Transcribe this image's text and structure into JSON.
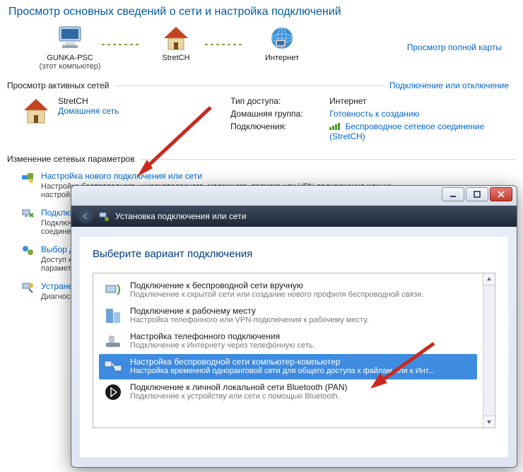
{
  "page": {
    "title": "Просмотр основных сведений о сети и настройка подключений",
    "full_map_link": "Просмотр полной карты"
  },
  "map": {
    "node1": {
      "name": "GUNKA-PSC",
      "sub": "(этот компьютер)"
    },
    "node2": {
      "name": "StretCH"
    },
    "node3": {
      "name": "Интернет"
    }
  },
  "active": {
    "header": "Просмотр активных сетей",
    "toggle": "Подключение или отключение",
    "network": {
      "name": "StretCH",
      "type": "Домашняя сеть"
    },
    "detail": {
      "access_label": "Тип доступа:",
      "access_value": "Интернет",
      "homegroup_label": "Домашняя группа:",
      "homegroup_value": "Готовность к созданию",
      "conn_label": "Подключения:",
      "conn_value": "Беспроводное сетевое соединение (StretCH)"
    }
  },
  "change": {
    "header": "Изменение сетевых параметров"
  },
  "tasks": [
    {
      "title": "Настройка нового подключения или сети",
      "sub": "Настройка беспроводного, широкополосного, модемного, прямого или VPN-подключения или же настройка маршрутизатора или точки доступа."
    },
    {
      "title": "Подключиться к сети",
      "sub": "Подключение или повторное подключение к беспроводному, проводному, модемному сетевому соединению или подключение к VPN."
    },
    {
      "title": "Выбор домашней группы и параметров общего доступа",
      "sub": "Доступ к файлам и принтерам, расположенным на других сетевых компьютерах, или изменение параметров общего доступа."
    },
    {
      "title": "Устранение неполадок",
      "sub": "Диагностика и исправление сетевых проблем или получение сведений об устранении."
    }
  ],
  "dialog": {
    "toolbar_title": "Установка подключения или сети",
    "heading": "Выберите вариант подключения",
    "options": [
      {
        "title": "Подключение к беспроводной сети вручную",
        "sub": "Подключение к скрытой сети или создание нового профиля беспроводной связи."
      },
      {
        "title": "Подключение к рабочему месту",
        "sub": "Настройка телефонного или VPN-подключения к рабочему месту."
      },
      {
        "title": "Настройка телефонного подключения",
        "sub": "Подключение к Интернету через телефонную сеть."
      },
      {
        "title": "Настройка беспроводной сети компьютер-компьютер",
        "sub": "Настройка временной одноранговой сети для общего доступа к файлам или к Инт..."
      },
      {
        "title": "Подключение к личной локальной сети Bluetooth (PAN)",
        "sub": "Подключение к устройству или сети с помощью Bluetooth."
      }
    ]
  }
}
